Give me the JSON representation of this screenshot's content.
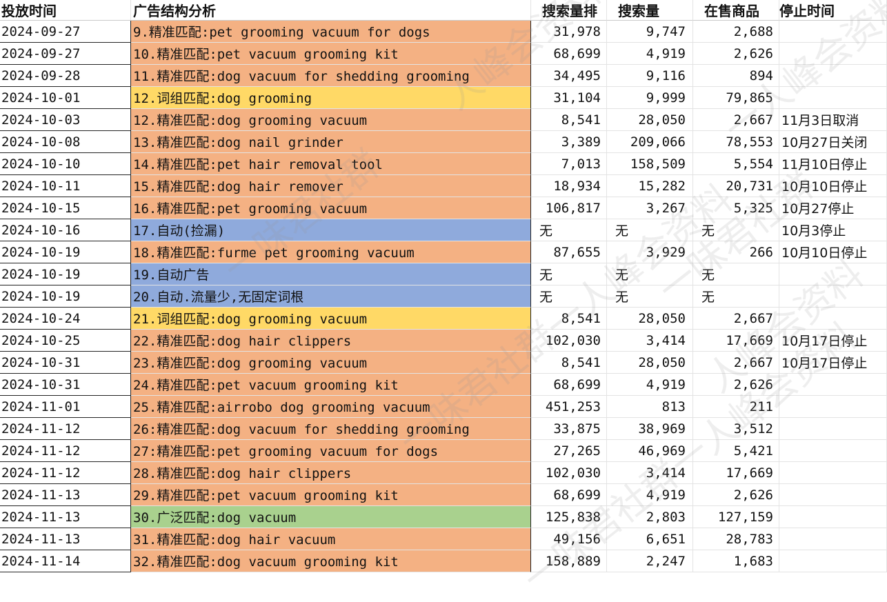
{
  "colors": {
    "exact": "#f4b183",
    "phrase": "#ffd966",
    "auto": "#8faadc",
    "broad": "#a9d18e"
  },
  "headers": {
    "date": "投放时间",
    "ad_structure": "广告结构分析",
    "search_rank": "搜索量排",
    "search_volume": "搜索量",
    "on_sale": "在售商品",
    "stop_time": "停止时间"
  },
  "rows": [
    {
      "date": "2024-09-27",
      "ad": "9.精准匹配:pet grooming vacuum for dogs",
      "rank": "31,978",
      "volume": "9,747",
      "onsale": "2,688",
      "stop": "",
      "type": "exact"
    },
    {
      "date": "2024-09-27",
      "ad": "10.精准匹配:pet vacuum grooming kit",
      "rank": "68,699",
      "volume": "4,919",
      "onsale": "2,626",
      "stop": "",
      "type": "exact"
    },
    {
      "date": "2024-09-28",
      "ad": "11.精准匹配:dog vacuum for shedding grooming",
      "rank": "34,495",
      "volume": "9,116",
      "onsale": "894",
      "stop": "",
      "type": "exact"
    },
    {
      "date": "2024-10-01",
      "ad": "12.词组匹配:dog grooming",
      "rank": "31,104",
      "volume": "9,999",
      "onsale": "79,865",
      "stop": "",
      "type": "phrase"
    },
    {
      "date": "2024-10-03",
      "ad": "12.精准匹配:dog grooming vacuum",
      "rank": "8,541",
      "volume": "28,050",
      "onsale": "2,667",
      "stop": "11月3日取消",
      "type": "exact"
    },
    {
      "date": "2024-10-08",
      "ad": "13.精准匹配:dog nail grinder",
      "rank": "3,389",
      "volume": "209,066",
      "onsale": "78,553",
      "stop": "10月27日关闭",
      "type": "exact"
    },
    {
      "date": "2024-10-10",
      "ad": "14.精准匹配:pet hair removal tool",
      "rank": "7,013",
      "volume": "158,509",
      "onsale": "5,554",
      "stop": "11月10日停止",
      "type": "exact"
    },
    {
      "date": "2024-10-11",
      "ad": "15.精准匹配:dog hair remover",
      "rank": "18,934",
      "volume": "15,282",
      "onsale": "20,731",
      "stop": "10月10日停止",
      "type": "exact"
    },
    {
      "date": "2024-10-15",
      "ad": "16.精准匹配:pet grooming vacuum",
      "rank": "106,817",
      "volume": "3,267",
      "onsale": "5,325",
      "stop": "10月27停止",
      "type": "exact"
    },
    {
      "date": "2024-10-16",
      "ad": "17.自动(捡漏)",
      "rank": "无",
      "volume": "无",
      "onsale": "无",
      "stop": "10月3停止",
      "type": "auto"
    },
    {
      "date": "2024-10-19",
      "ad": "18.精准匹配:furme pet grooming vacuum",
      "rank": "87,655",
      "volume": "3,929",
      "onsale": "266",
      "stop": "10月10日停止",
      "type": "exact"
    },
    {
      "date": "2024-10-19",
      "ad": "19.自动广告",
      "rank": "无",
      "volume": "无",
      "onsale": "无",
      "stop": "",
      "type": "auto"
    },
    {
      "date": "2024-10-19",
      "ad": "20.自动.流量少,无固定词根",
      "rank": "无",
      "volume": "无",
      "onsale": "无",
      "stop": "",
      "type": "auto"
    },
    {
      "date": "2024-10-24",
      "ad": "21.词组匹配:dog grooming vacuum",
      "rank": "8,541",
      "volume": "28,050",
      "onsale": "2,667",
      "stop": "",
      "type": "phrase"
    },
    {
      "date": "2024-10-25",
      "ad": "22.精准匹配:dog hair clippers",
      "rank": "102,030",
      "volume": "3,414",
      "onsale": "17,669",
      "stop": "10月17日停止",
      "type": "exact"
    },
    {
      "date": "2024-10-31",
      "ad": "23.精准匹配:dog grooming vacuum",
      "rank": "8,541",
      "volume": "28,050",
      "onsale": "2,667",
      "stop": "10月17日停止",
      "type": "exact"
    },
    {
      "date": "2024-10-31",
      "ad": "24.精准匹配:pet vacuum grooming kit",
      "rank": "68,699",
      "volume": "4,919",
      "onsale": "2,626",
      "stop": "",
      "type": "exact"
    },
    {
      "date": "2024-11-01",
      "ad": "25.精准匹配:airrobo dog grooming vacuum",
      "rank": "451,253",
      "volume": "813",
      "onsale": "211",
      "stop": "",
      "type": "exact"
    },
    {
      "date": "2024-11-12",
      "ad": "26:精准匹配:dog vacuum for shedding grooming",
      "rank": "33,875",
      "volume": "38,969",
      "onsale": "3,512",
      "stop": "",
      "type": "exact"
    },
    {
      "date": "2024-11-12",
      "ad": "27:精准匹配:pet grooming vacuum for dogs",
      "rank": "27,265",
      "volume": "46,969",
      "onsale": "5,421",
      "stop": "",
      "type": "exact"
    },
    {
      "date": "2024-11-12",
      "ad": "28.精准匹配:dog hair clippers",
      "rank": "102,030",
      "volume": "3,414",
      "onsale": "17,669",
      "stop": "",
      "type": "exact"
    },
    {
      "date": "2024-11-13",
      "ad": "29.精准匹配:pet vacuum grooming kit",
      "rank": "68,699",
      "volume": "4,919",
      "onsale": "2,626",
      "stop": "",
      "type": "exact"
    },
    {
      "date": "2024-11-13",
      "ad": "30.广泛匹配:dog vacuum",
      "rank": "125,838",
      "volume": "2,803",
      "onsale": "127,159",
      "stop": "",
      "type": "broad"
    },
    {
      "date": "2024-11-13",
      "ad": "31.精准匹配:dog hair vacuum",
      "rank": "49,156",
      "volume": "6,651",
      "onsale": "28,783",
      "stop": "",
      "type": "exact"
    },
    {
      "date": "2024-11-14",
      "ad": "32.精准匹配:dog vacuum grooming kit",
      "rank": "158,889",
      "volume": "2,247",
      "onsale": "1,683",
      "stop": "",
      "type": "exact"
    }
  ],
  "watermarks": [
    "人峰会资料",
    "一味君社群",
    "一味君社群一人峰会资料",
    "一味君社群",
    "一人峰会资料",
    "一味君社群一人峰会资料",
    "人峰会资料"
  ]
}
